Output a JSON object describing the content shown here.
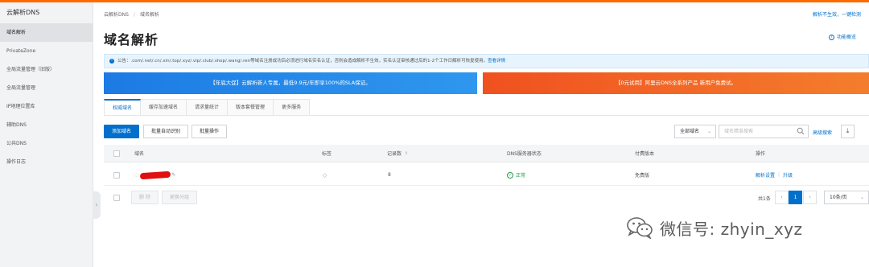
{
  "sidebar": {
    "title": "云解析DNS",
    "items": [
      {
        "label": "域名解析",
        "active": true
      },
      {
        "label": "PrivateZone"
      },
      {
        "label": "全局流量管理（旧版）"
      },
      {
        "label": "全局流量管理"
      },
      {
        "label": "IP地理位置库"
      },
      {
        "label": "辅助DNS"
      },
      {
        "label": "公共DNS"
      },
      {
        "label": "操作日志"
      }
    ]
  },
  "header": {
    "breadcrumb": [
      "云解析DNS",
      "域名解析"
    ],
    "top_link": "解析不生效，一键检测",
    "title": "域名解析",
    "help_link": "功能概览"
  },
  "notice": {
    "text": "公告：.com/.net/.cn/.xin/.top/.xyz/.vip/.club/.shop/.wang/.ren等域名注册成功后必须进行域名实名认证，否则会造成解析不生效，实名认证审核通过后的1-2个工作日解析可恢复使用。",
    "link": "查看详情"
  },
  "banners": {
    "left": "【年底大促】云解析新人专属，最低9.9元/年即享100%的SLA保证。",
    "right": "【0元试用】阿里云DNS全系列产品 新用户免费试。"
  },
  "tabs": [
    "权威域名",
    "缓存加速域名",
    "请求量统计",
    "版本套餐管理",
    "更多服务"
  ],
  "toolbar": {
    "add_domain": "添加域名",
    "batch_recognize": "批量自动识别",
    "batch_ops": "批量操作",
    "filter_select": "全部域名",
    "search_placeholder": "域名精准搜索",
    "advanced_search": "高级搜索"
  },
  "table": {
    "headers": [
      "域名",
      "标签",
      "记录数",
      "DNS服务器状态",
      "付费版本",
      "操作"
    ],
    "rows": [
      {
        "domain_suffix": "☑",
        "tag_icon": "tag-icon",
        "records": "8",
        "dns_status": "正常",
        "plan": "免费版",
        "action_primary": "解析设置",
        "action_secondary": "升级"
      }
    ]
  },
  "footer": {
    "delete": "删 除",
    "change_group": "更换分组",
    "total": "共1条",
    "current_page": "1",
    "page_size": "10条/页"
  },
  "watermark": {
    "text": "微信号: zhyin_xyz"
  },
  "colors": {
    "accent": "#0070cc",
    "topbar": "#ff6a00",
    "banner_blue": "#1c7be4",
    "banner_orange": "#f0511f",
    "ok": "#1e9c4a",
    "redaction": "#e01010"
  }
}
